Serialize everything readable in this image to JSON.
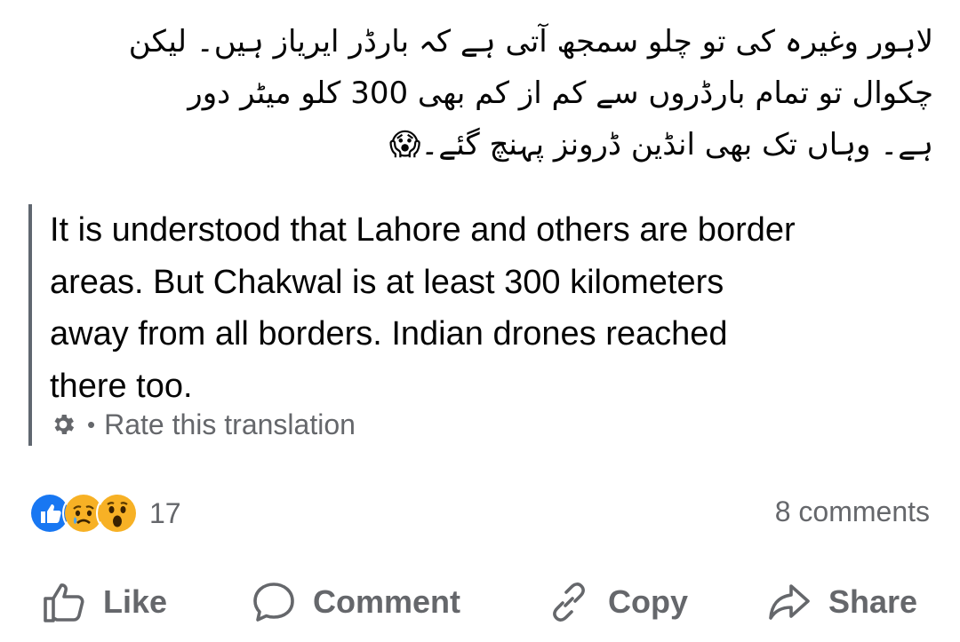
{
  "post": {
    "original_text_lines": [
      "لاہور وغیرہ کی تو چلو سمجھ آتی ہے کہ بارڈر ایریاز ہیں۔ لیکن",
      "چکوال تو تمام بارڈروں سے کم از کم بھی 300 کلو میٹر دور",
      "ہے۔ وہاں تک بھی انڈین ڈرونز پہنچ گئے۔😱"
    ],
    "translation_lines": [
      "It is understood that Lahore and others are border",
      "areas. But Chakwal is at least 300 kilometers",
      "away from all borders. Indian drones reached",
      "there too."
    ],
    "rate_separator": "•",
    "rate_translation_label": "Rate this translation",
    "settings_icon": "gear-icon"
  },
  "stats": {
    "reaction_icons": [
      "like-reaction-icon",
      "sad-reaction-icon",
      "wow-reaction-icon"
    ],
    "reaction_count": "17",
    "comments_count": "8 comments"
  },
  "actions": {
    "like_label": "Like",
    "comment_label": "Comment",
    "copy_label": "Copy",
    "share_label": "Share"
  },
  "colors": {
    "text_primary": "#050505",
    "text_secondary": "#65676b",
    "like_blue": "#1877f2",
    "reaction_yellow": "#f7b125",
    "quote_bar": "#606770"
  }
}
